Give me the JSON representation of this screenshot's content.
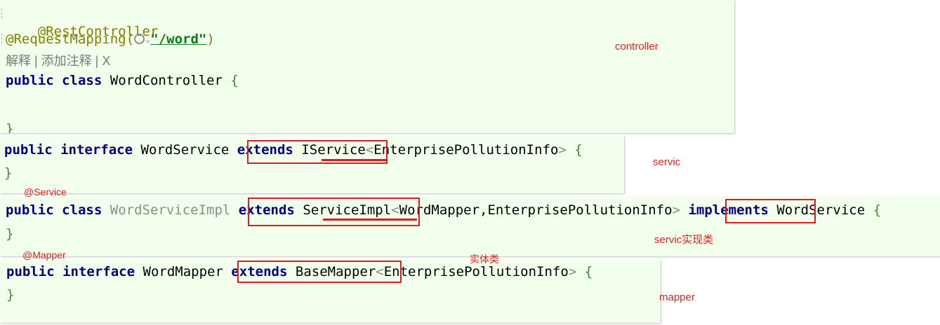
{
  "controller": {
    "line1": "@RestController",
    "line2_prefix": "@RequestMapping(",
    "line2_path": "\"/word\"",
    "line2_suffix": ")",
    "hint": "解释 | 添加注释 | X",
    "decl_kw1": "public",
    "decl_kw2": "class",
    "decl_name": "WordController",
    "open_brace": "{",
    "close_brace": "}"
  },
  "service": {
    "kw1": "public",
    "kw2": "interface",
    "name": "WordService",
    "extends_kw": "extends",
    "parent": "IService",
    "generic_open": "<",
    "generic": "EnterprisePollutionInfo",
    "generic_close": ">",
    "open_brace": "{",
    "close_brace": "}"
  },
  "service_impl": {
    "kw1": "public",
    "kw2": "class",
    "name": "WordServiceImpl",
    "extends_kw": "extends",
    "parent": "ServiceImpl",
    "generic_open": "<",
    "generic": "WordMapper,EnterprisePollutionInfo",
    "generic_close": ">",
    "implements_kw": "implements",
    "iface": "WordService",
    "open_brace": "{",
    "close_brace": "}"
  },
  "mapper": {
    "kw1": "public",
    "kw2": "interface",
    "name": "WordMapper",
    "extends_kw": "extends",
    "parent": "BaseMapper",
    "generic_open": "<",
    "generic": "EnterprisePollutionInfo",
    "generic_close": ">",
    "open_brace": "{",
    "close_brace": "}"
  },
  "labels": {
    "controller": "controller",
    "servic": "servic",
    "service_annotation": "@Service",
    "servic_impl": "servic实现类",
    "mapper_annotation": "@Mapper",
    "entity": "实体类",
    "mapper": "mapper"
  },
  "colors": {
    "panel_bg": "#f2ffec",
    "keyword": "#000080",
    "annotation": "#808000",
    "string": "#067d17",
    "highlight_red": "#d42020"
  }
}
